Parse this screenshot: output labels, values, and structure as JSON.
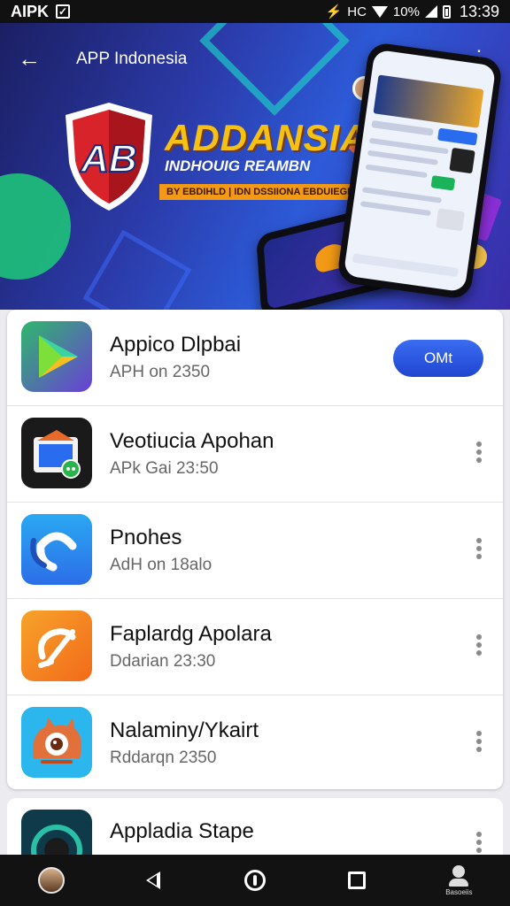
{
  "status_bar": {
    "left_text": "AIPK",
    "network_text": "HC",
    "battery_text": "10%",
    "time": "13:39"
  },
  "banner": {
    "back_label": "←",
    "title": "APP Indonesia",
    "shield_text": "AB",
    "headline": "ADDANSIA",
    "subhead": "INDHOUIG REAMBN",
    "tagline": "BY EBDIHLD | IDN DSSIIONA EBDUIEGN"
  },
  "apps": [
    {
      "name": "Appico Dlpbai",
      "subtitle": "APH on 2350",
      "icon": "play-store-icon",
      "action": "OMt"
    },
    {
      "name": "Veotiucia Apohan",
      "subtitle": "APk Gai 23:50",
      "icon": "photo-folder-icon"
    },
    {
      "name": "Pnohes",
      "subtitle": "AdH on 18alo",
      "icon": "phone-icon"
    },
    {
      "name": "Faplardg Apolara",
      "subtitle": "Ddarian 23:30",
      "icon": "paint-icon"
    },
    {
      "name": "Nalaminy/Ykairt",
      "subtitle": "Rddarqn 2350",
      "icon": "monster-icon"
    },
    {
      "name": "Appladia Stape",
      "subtitle": "",
      "icon": "store-icon"
    }
  ],
  "nav": {
    "profile_label": "Basoeiis"
  },
  "colors": {
    "accent_blue": "#2a56e0",
    "banner_yellow": "#f5c214"
  }
}
